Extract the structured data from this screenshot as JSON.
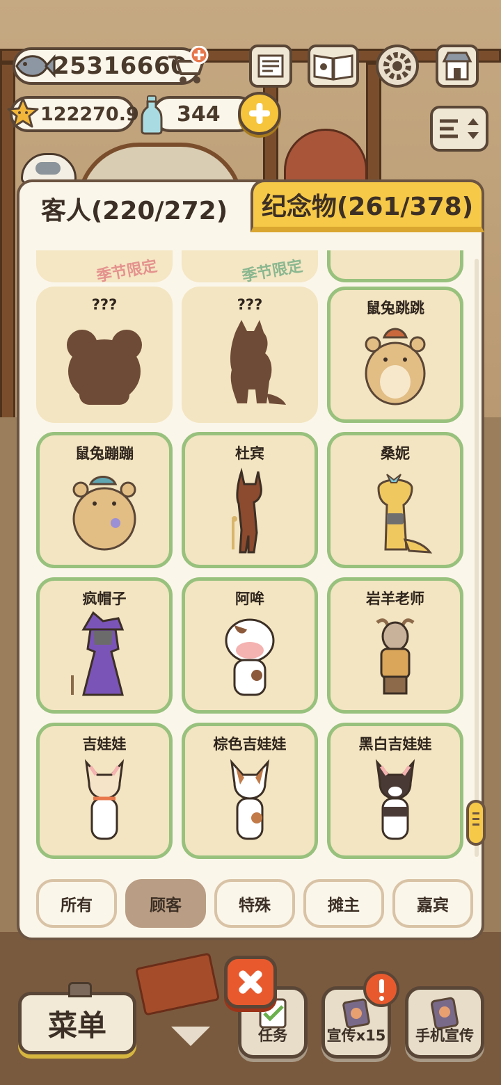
{
  "hud": {
    "fish_count": "25316660",
    "star_rating": "122270.9",
    "bottle_count": "344"
  },
  "tabs": [
    {
      "label": "客人(220/272)",
      "active": true
    },
    {
      "label": "纪念物(261/378)",
      "active": false
    }
  ],
  "partial_row_stamp": "季节限定",
  "cards": [
    {
      "name": "???",
      "locked": true,
      "icon": "bear-silhouette"
    },
    {
      "name": "???",
      "locked": true,
      "icon": "wolf-silhouette"
    },
    {
      "name": "鼠兔跳跳",
      "locked": false,
      "icon": "hamster-hat"
    },
    {
      "name": "鼠兔蹦蹦",
      "locked": false,
      "icon": "hamster-cap"
    },
    {
      "name": "杜宾",
      "locked": false,
      "icon": "doberman"
    },
    {
      "name": "桑妮",
      "locked": false,
      "icon": "gecko"
    },
    {
      "name": "疯帽子",
      "locked": false,
      "icon": "wolf-purple-hat"
    },
    {
      "name": "阿哞",
      "locked": false,
      "icon": "cow"
    },
    {
      "name": "岩羊老师",
      "locked": false,
      "icon": "goat"
    },
    {
      "name": "吉娃娃",
      "locked": false,
      "icon": "chihuahua"
    },
    {
      "name": "棕色吉娃娃",
      "locked": false,
      "icon": "chihuahua-brown"
    },
    {
      "name": "黑白吉娃娃",
      "locked": false,
      "icon": "chihuahua-black"
    }
  ],
  "filters": [
    {
      "label": "所有",
      "active": false
    },
    {
      "label": "顾客",
      "active": true
    },
    {
      "label": "特殊",
      "active": false
    },
    {
      "label": "摊主",
      "active": false
    },
    {
      "label": "嘉宾",
      "active": false
    }
  ],
  "bottom": {
    "menu_label": "菜单",
    "task_label": "任务",
    "promo_label": "宣传x15",
    "phone_promo_label": "手机宣传"
  },
  "colors": {
    "unlocked_border": "#98c17d",
    "card_bg": "#f3e5c1",
    "tab_active": "#fbf6ea",
    "tab_inactive": "#f6c948",
    "silhouette": "#6e4b37"
  }
}
